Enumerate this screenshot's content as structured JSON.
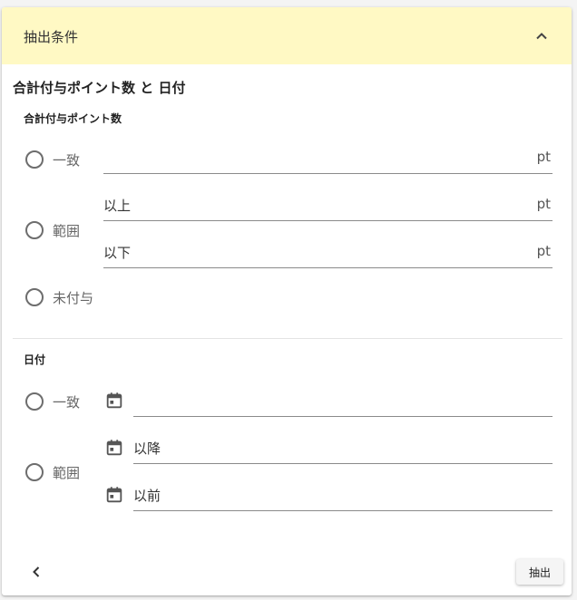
{
  "header": {
    "title": "抽出条件",
    "collapse_icon": "chevron-up-icon"
  },
  "section": {
    "title": "合計付与ポイント数 と 日付"
  },
  "points": {
    "title": "合計付与ポイント数",
    "exact_label": "一致",
    "range_label": "範囲",
    "none_label": "未付与",
    "unit": "pt",
    "min_placeholder": "以上",
    "max_placeholder": "以下"
  },
  "date": {
    "title": "日付",
    "exact_label": "一致",
    "range_label": "範囲",
    "from_placeholder": "以降",
    "to_placeholder": "以前",
    "calendar_icon": "calendar-icon"
  },
  "footer": {
    "back_icon": "chevron-left-icon",
    "extract_label": "抽出"
  }
}
